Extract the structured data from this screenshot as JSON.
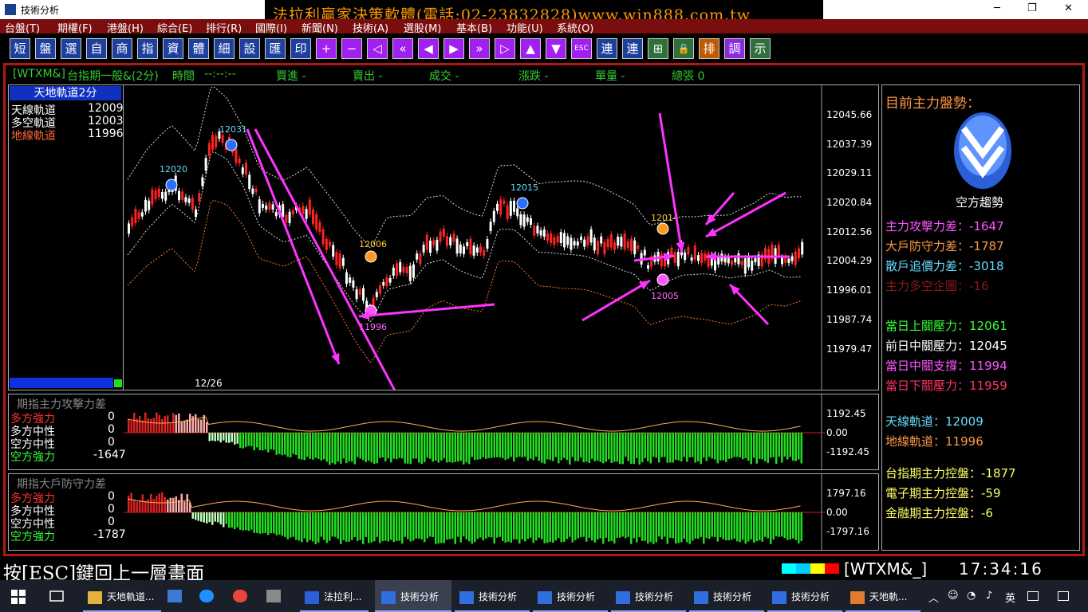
{
  "window": {
    "title": "技術分析",
    "ad_banner": "法拉利贏家決策軟體(電話:02-23832828)www.win888.com.tw",
    "min": "─",
    "max": "❐",
    "close": "✕"
  },
  "menu": [
    "台盤(T)",
    "期權(F)",
    "港盤(H)",
    "綜合(E)",
    "排行(R)",
    "國際(I)",
    "新聞(N)",
    "技術(A)",
    "選股(M)",
    "基本(B)",
    "功能(U)",
    "系統(O)"
  ],
  "toolbar": [
    "短",
    "盤",
    "選",
    "自",
    "商",
    "指",
    "資",
    "體",
    "細",
    "設",
    "匯",
    "印",
    "+",
    "−",
    "◁",
    "«",
    "◀",
    "▶",
    "»",
    "▷",
    "▲",
    "▼",
    "ESC",
    "連",
    "連",
    "⊞",
    "🔒",
    "排",
    "調",
    "示"
  ],
  "status": {
    "symbol": "[WTXM&]",
    "name": "台指期一般&(2分)",
    "time_label": "時間",
    "time_value": "--:--:--",
    "buy": "買進 -",
    "sell": "賣出 -",
    "deal": "成交 -",
    "change": "漲跌 -",
    "volume": "單量 -",
    "total": "總張 0"
  },
  "leftpane": {
    "header": "天地軌道2分",
    "rows": [
      {
        "label": "天線軌道",
        "value": "12009",
        "color": "#ffffff"
      },
      {
        "label": "多空軌道",
        "value": "12003",
        "color": "#ffffff"
      },
      {
        "label": "地線軌道",
        "value": "11996",
        "color": "#ff6633"
      }
    ]
  },
  "main_axis": [
    "12045.66",
    "12037.39",
    "12029.11",
    "12020.84",
    "12012.56",
    "12004.29",
    "11996.01",
    "11987.74",
    "11979.47"
  ],
  "date_label": "12/26",
  "markers": [
    {
      "label": "12020",
      "kind": "down"
    },
    {
      "label": "12031",
      "kind": "down"
    },
    {
      "label": "12006",
      "kind": "orange"
    },
    {
      "label": "11996",
      "kind": "up"
    },
    {
      "label": "12015",
      "kind": "down"
    },
    {
      "label": "12014",
      "kind": "orange"
    },
    {
      "label": "12005",
      "kind": "up"
    }
  ],
  "sub1": {
    "title": "期指主力攻擊力差",
    "rows": [
      {
        "label": "多方強力",
        "value": "0",
        "color": "#ff3333"
      },
      {
        "label": "多方中性",
        "value": "0",
        "color": "#ffffff"
      },
      {
        "label": "空方中性",
        "value": "0",
        "color": "#ffffff"
      },
      {
        "label": "空方強力",
        "value": "-1647",
        "color": "#33ff33"
      }
    ],
    "axis": [
      "1192.45",
      "0.00",
      "-1192.45"
    ]
  },
  "sub2": {
    "title": "期指大戶防守力差",
    "rows": [
      {
        "label": "多方強力",
        "value": "0",
        "color": "#ff3333"
      },
      {
        "label": "多方中性",
        "value": "0",
        "color": "#ffffff"
      },
      {
        "label": "空方中性",
        "value": "0",
        "color": "#ffffff"
      },
      {
        "label": "空方強力",
        "value": "-1787",
        "color": "#33ff33"
      }
    ],
    "axis": [
      "1797.16",
      "0.00",
      "-1797.16"
    ]
  },
  "rightpanel": {
    "header": "目前主力盤勢：",
    "trend_label": "空方趨勢",
    "stats": [
      {
        "label": "主力攻擊力差：",
        "value": "-1647",
        "color": "#ff55ff"
      },
      {
        "label": "大戶防守力差：",
        "value": "-1787",
        "color": "#ff9944"
      },
      {
        "label": "散戶追價力差：",
        "value": "-3018",
        "color": "#66ddff"
      },
      {
        "label": "主力多空企圖：",
        "value": "-16",
        "color": "#8b1a1a"
      }
    ],
    "levels": [
      {
        "label": "當日上關壓力：",
        "value": "12061",
        "color": "#33ff33"
      },
      {
        "label": "前日中關壓力：",
        "value": "12045",
        "color": "#ffffff"
      },
      {
        "label": "當日中關支撐：",
        "value": "11994",
        "color": "#ff55ff"
      },
      {
        "label": "當日下關壓力：",
        "value": "11959",
        "color": "#ff3366"
      }
    ],
    "tracks": [
      {
        "label": "天線軌道：",
        "value": "12009",
        "color": "#66ddff"
      },
      {
        "label": "地線軌道：",
        "value": "11996",
        "color": "#ff9944"
      }
    ],
    "control": [
      {
        "label": "台指期主力控盤：",
        "value": "-1877",
        "color": "#ffff66"
      },
      {
        "label": "電子期主力控盤：",
        "value": "-59",
        "color": "#ffff66"
      },
      {
        "label": "金融期主力控盤：",
        "value": "-6",
        "color": "#ffff66"
      }
    ]
  },
  "bottom": {
    "esc_hint": "按[ESC]鍵回上一層畫面",
    "symbol": "[WTXM&_]",
    "clock": "17:34:16"
  },
  "taskbar": {
    "items": [
      "天地軌道...",
      "法拉利...",
      "技術分析",
      "技術分析",
      "技術分析",
      "技術分析",
      "技術分析",
      "技術分析",
      "天地軌..."
    ],
    "ime": "英"
  },
  "colors": {
    "menu_bg": "#7a0d0d",
    "frame": "#b01818",
    "up": "#ff2222",
    "down": "#ffffff",
    "magenta": "#ff33ff",
    "green_bar": "#33dd33",
    "red_bar": "#cc2222"
  }
}
